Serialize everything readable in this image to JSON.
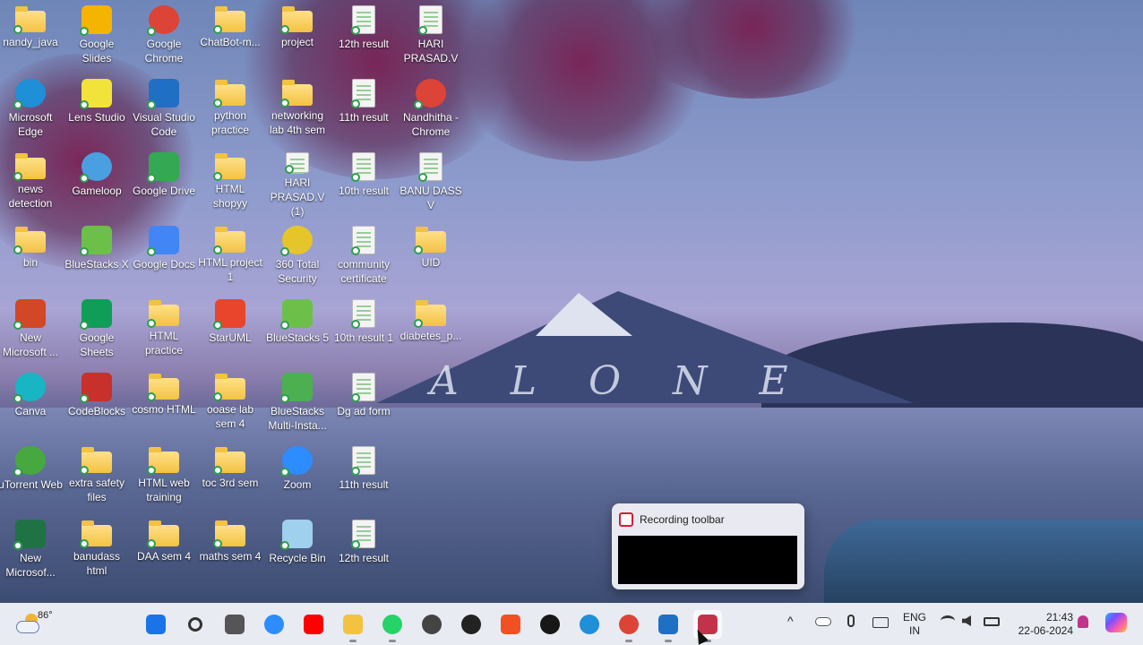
{
  "wallpaper": {
    "text": "A L O N E"
  },
  "desktop_icons": [
    {
      "label": "nandy_java",
      "type": "folder",
      "icon": "folder-icon"
    },
    {
      "label": "Google\nSlides",
      "type": "app",
      "icon": "google-slides-icon",
      "color": "#f4b400"
    },
    {
      "label": "Google\nChrome",
      "type": "round",
      "icon": "chrome-icon",
      "color": "#db4437"
    },
    {
      "label": "ChatBot-m...",
      "type": "folder",
      "icon": "folder-icon"
    },
    {
      "label": "project",
      "type": "folder",
      "icon": "folder-icon"
    },
    {
      "label": "12th result",
      "type": "doc",
      "icon": "document-icon"
    },
    {
      "label": "HARI\nPRASAD.V",
      "type": "doc",
      "icon": "document-icon"
    },
    {
      "label": "Microsoft\nEdge",
      "type": "round",
      "icon": "edge-icon",
      "color": "#1f8fd8"
    },
    {
      "label": "Lens Studio",
      "type": "app",
      "icon": "lens-studio-icon",
      "color": "#f2e33a"
    },
    {
      "label": "Visual Studio\nCode",
      "type": "app",
      "icon": "vscode-icon",
      "color": "#1f6fc4"
    },
    {
      "label": "python\npractice",
      "type": "folder",
      "icon": "folder-icon"
    },
    {
      "label": "networking\nlab 4th sem",
      "type": "folder",
      "icon": "folder-icon"
    },
    {
      "label": "11th result",
      "type": "doc",
      "icon": "document-icon"
    },
    {
      "label": "Nandhitha -\nChrome",
      "type": "round",
      "icon": "chrome-icon",
      "color": "#db4437"
    },
    {
      "label": "news\ndetection",
      "type": "folder",
      "icon": "folder-icon"
    },
    {
      "label": "Gameloop",
      "type": "round",
      "icon": "gameloop-icon",
      "color": "#4a9fe0"
    },
    {
      "label": "Google Drive",
      "type": "app",
      "icon": "google-drive-icon",
      "color": "#34a853"
    },
    {
      "label": "HTML\nshopyy",
      "type": "folder",
      "icon": "folder-icon"
    },
    {
      "label": "HARI\nPRASAD.V (1)",
      "type": "doc",
      "icon": "document-icon"
    },
    {
      "label": "10th result",
      "type": "doc",
      "icon": "document-icon"
    },
    {
      "label": "BANU DASS\nV",
      "type": "doc",
      "icon": "document-icon"
    },
    {
      "label": "bin",
      "type": "folder",
      "icon": "folder-icon"
    },
    {
      "label": "BlueStacks X",
      "type": "app",
      "icon": "bluestacks-icon",
      "color": "#6cc04a"
    },
    {
      "label": "Google Docs",
      "type": "app",
      "icon": "google-docs-icon",
      "color": "#4285f4"
    },
    {
      "label": "HTML project\n1",
      "type": "folder",
      "icon": "folder-icon"
    },
    {
      "label": "360 Total\nSecurity",
      "type": "round",
      "icon": "security-icon",
      "color": "#e5c52a"
    },
    {
      "label": "community\ncertificate",
      "type": "doc",
      "icon": "document-icon"
    },
    {
      "label": "UID",
      "type": "folder",
      "icon": "folder-icon"
    },
    {
      "label": "New\nMicrosoft ...",
      "type": "app",
      "icon": "powerpoint-icon",
      "color": "#d24726"
    },
    {
      "label": "Google\nSheets",
      "type": "app",
      "icon": "google-sheets-icon",
      "color": "#0f9d58"
    },
    {
      "label": "HTML\npractice",
      "type": "folder",
      "icon": "folder-icon"
    },
    {
      "label": "StarUML",
      "type": "app",
      "icon": "staruml-icon",
      "color": "#e8452c"
    },
    {
      "label": "BlueStacks 5",
      "type": "app",
      "icon": "bluestacks-icon",
      "color": "#6cc04a"
    },
    {
      "label": "10th result 1",
      "type": "doc",
      "icon": "document-icon"
    },
    {
      "label": "diabetes_p...",
      "type": "folder",
      "icon": "folder-icon"
    },
    {
      "label": "Canva",
      "type": "round",
      "icon": "canva-icon",
      "color": "#18b5c4"
    },
    {
      "label": "CodeBlocks",
      "type": "app",
      "icon": "codeblocks-icon",
      "color": "#c8302c"
    },
    {
      "label": "cosmo HTML",
      "type": "folder",
      "icon": "folder-icon"
    },
    {
      "label": "ooase lab\nsem 4",
      "type": "folder",
      "icon": "folder-icon"
    },
    {
      "label": "BlueStacks\nMulti-Insta...",
      "type": "app",
      "icon": "bluestacks-icon",
      "color": "#4caf50"
    },
    {
      "label": "Dg ad form",
      "type": "doc",
      "icon": "document-icon"
    },
    {
      "label": "uTorrent Web",
      "type": "round",
      "icon": "utorrent-icon",
      "color": "#47a83f"
    },
    {
      "label": "extra safety\nfiles",
      "type": "folder",
      "icon": "folder-icon"
    },
    {
      "label": "HTML web\ntraining",
      "type": "folder",
      "icon": "folder-icon"
    },
    {
      "label": "toc 3rd sem",
      "type": "folder",
      "icon": "folder-icon"
    },
    {
      "label": "Zoom",
      "type": "round",
      "icon": "zoom-icon",
      "color": "#2d8cff"
    },
    {
      "label": "11th result",
      "type": "doc",
      "icon": "document-icon"
    },
    {
      "label": "New\nMicrosof...",
      "type": "app",
      "icon": "excel-icon",
      "color": "#1f7244"
    },
    {
      "label": "banudass\nhtml",
      "type": "folder",
      "icon": "folder-icon"
    },
    {
      "label": "DAA sem 4",
      "type": "folder",
      "icon": "folder-icon"
    },
    {
      "label": "maths sem 4",
      "type": "folder",
      "icon": "folder-icon"
    },
    {
      "label": "Recycle Bin",
      "type": "app",
      "icon": "recycle-bin-icon",
      "color": "#9fd0ee"
    },
    {
      "label": "12th result",
      "type": "doc",
      "icon": "document-icon"
    }
  ],
  "recording_popup": {
    "title": "Recording toolbar"
  },
  "taskbar": {
    "weather": {
      "temp": "86°"
    },
    "apps": [
      {
        "name": "start",
        "icon": "windows-start-icon",
        "color": "#1a73e8"
      },
      {
        "name": "search",
        "icon": "search-icon",
        "color": "#333333"
      },
      {
        "name": "task-view",
        "icon": "task-view-icon",
        "color": "#555555"
      },
      {
        "name": "zoom",
        "icon": "zoom-icon",
        "color": "#2d8cff"
      },
      {
        "name": "youtube",
        "icon": "youtube-icon",
        "color": "#ff0000"
      },
      {
        "name": "file-explorer",
        "icon": "folder-icon",
        "color": "#f3c241",
        "open": true
      },
      {
        "name": "whatsapp",
        "icon": "whatsapp-icon",
        "color": "#25d366",
        "open": true
      },
      {
        "name": "dell",
        "icon": "dell-icon",
        "color": "#444444"
      },
      {
        "name": "chatgpt",
        "icon": "chatgpt-icon",
        "color": "#222222"
      },
      {
        "name": "microsoft-store",
        "icon": "store-icon",
        "color": "#f25022"
      },
      {
        "name": "github",
        "icon": "github-icon",
        "color": "#181717"
      },
      {
        "name": "edge",
        "icon": "edge-icon",
        "color": "#1f8fd8"
      },
      {
        "name": "chrome",
        "icon": "chrome-icon",
        "color": "#db4437",
        "open": true
      },
      {
        "name": "vscode",
        "icon": "vscode-icon",
        "color": "#1f6fc4",
        "open": true
      },
      {
        "name": "snipping-tool",
        "icon": "snipping-tool-icon",
        "color": "#c2334a",
        "open": true,
        "active": true
      }
    ],
    "tray": {
      "chevron": "^",
      "lang_top": "ENG",
      "lang_bottom": "IN",
      "time": "21:43",
      "date": "22-06-2024"
    }
  }
}
